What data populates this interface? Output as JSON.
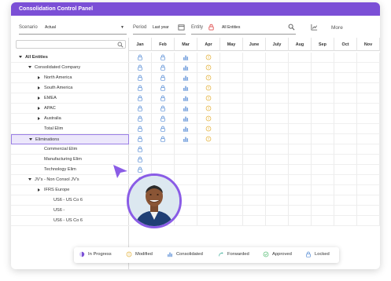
{
  "window": {
    "title": "Consolidation Control Panel"
  },
  "toolbar": {
    "scenario_label": "Scenario",
    "scenario_value": "Actual",
    "period_label": "Period",
    "period_value": "Last year",
    "entity_label": "Entity",
    "entity_value": "All Entities",
    "more_label": "More"
  },
  "grid": {
    "months": [
      "Jan",
      "Feb",
      "Mar",
      "Apr",
      "May",
      "June",
      "July",
      "Aug",
      "Sep",
      "Oct",
      "Nov"
    ],
    "rows": [
      {
        "label": "All Entities",
        "arrow": "down",
        "indent": 0,
        "statuses": [
          "locked",
          "locked",
          "consolidated",
          "modified"
        ]
      },
      {
        "label": "Consolidated Company",
        "arrow": "down",
        "indent": 1,
        "statuses": [
          "locked",
          "locked",
          "consolidated",
          "modified"
        ]
      },
      {
        "label": "North America",
        "arrow": "right",
        "indent": 2,
        "statuses": [
          "locked",
          "locked",
          "consolidated",
          "modified"
        ]
      },
      {
        "label": "South America",
        "arrow": "right",
        "indent": 2,
        "statuses": [
          "locked",
          "locked",
          "consolidated",
          "modified"
        ]
      },
      {
        "label": "EMEA",
        "arrow": "right",
        "indent": 2,
        "statuses": [
          "locked",
          "locked",
          "consolidated",
          "modified"
        ]
      },
      {
        "label": "APAC",
        "arrow": "right",
        "indent": 2,
        "statuses": [
          "locked",
          "locked",
          "consolidated",
          "modified"
        ]
      },
      {
        "label": "Australia",
        "arrow": "right",
        "indent": 2,
        "statuses": [
          "locked",
          "locked",
          "consolidated",
          "modified"
        ]
      },
      {
        "label": "Total Elim",
        "arrow": "none",
        "indent": 2,
        "statuses": [
          "locked",
          "locked",
          "consolidated",
          "modified"
        ]
      },
      {
        "label": "Eliminations",
        "arrow": "down",
        "indent": 1,
        "selected": true,
        "statuses": [
          "locked",
          "locked",
          "consolidated",
          "modified"
        ]
      },
      {
        "label": "Commercial Elim",
        "arrow": "none",
        "indent": 2,
        "statuses": [
          "locked",
          "",
          "",
          ""
        ]
      },
      {
        "label": "Manufacturing Elim",
        "arrow": "none",
        "indent": 2,
        "statuses": [
          "locked",
          "",
          "",
          ""
        ]
      },
      {
        "label": "Technology Elim",
        "arrow": "none",
        "indent": 2,
        "statuses": [
          "locked",
          "",
          "",
          ""
        ]
      },
      {
        "label": "JV's - Non Consol JV's",
        "arrow": "down",
        "indent": 1,
        "statuses": [
          "locked",
          "",
          "",
          ""
        ]
      },
      {
        "label": "IFRS Europe",
        "arrow": "right",
        "indent": 2,
        "statuses": [
          "locked",
          "",
          "",
          ""
        ]
      },
      {
        "label": "US6 - US Co 6",
        "arrow": "none",
        "indent": 3,
        "statuses": [
          "locked",
          "",
          "",
          ""
        ]
      },
      {
        "label": "US6 -",
        "arrow": "none",
        "indent": 3,
        "statuses": [
          "",
          "",
          "",
          ""
        ]
      },
      {
        "label": "US6 - US Co 6",
        "arrow": "none",
        "indent": 3,
        "statuses": [
          "",
          "",
          "",
          ""
        ]
      }
    ]
  },
  "legend": {
    "items": [
      {
        "key": "in_progress",
        "label": "In Progress"
      },
      {
        "key": "modified",
        "label": "Modified"
      },
      {
        "key": "consolidated",
        "label": "Consolidated"
      },
      {
        "key": "forwarded",
        "label": "Forwarded"
      },
      {
        "key": "approved",
        "label": "Approved"
      },
      {
        "key": "locked",
        "label": "Locked"
      }
    ]
  },
  "colors": {
    "accent": "#7b4fd6",
    "locked": "#5b8fd6",
    "consolidated": "#5b8fd6",
    "modified": "#e3b23c",
    "approved": "#5cc07a",
    "forwarded": "#4bb3a0"
  }
}
